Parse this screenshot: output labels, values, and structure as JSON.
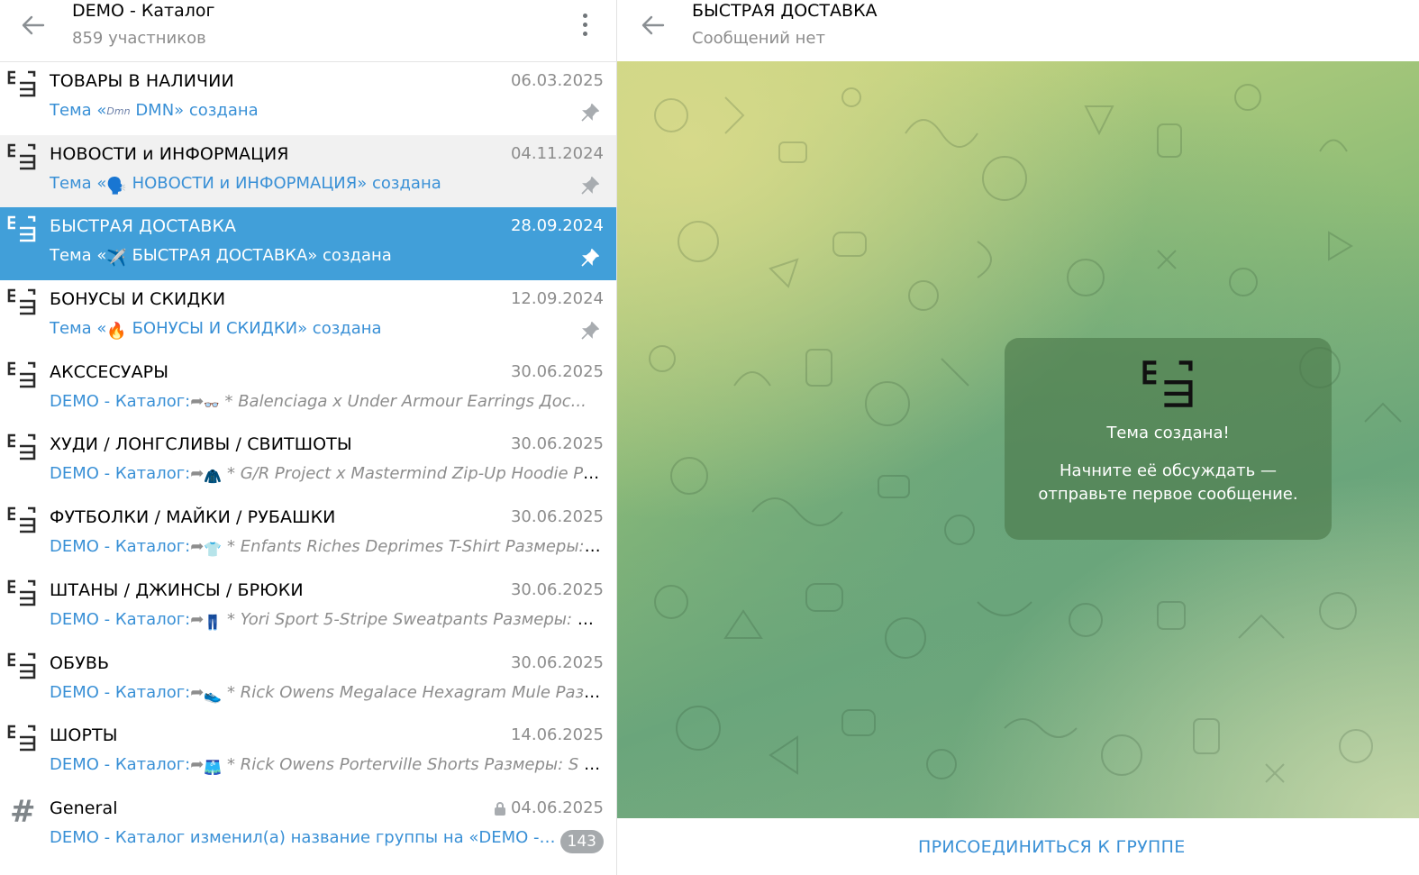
{
  "left_header": {
    "title": "DEMO - Каталог",
    "subtitle": "859 участников"
  },
  "topics": [
    {
      "title": "ТОВАРЫ В НАЛИЧИИ",
      "date": "06.03.2025",
      "pre": "Тема «",
      "emoji": "Dmn",
      "post": " DMN» создана",
      "pinned": true
    },
    {
      "title": "НОВОСТИ и ИНФОРМАЦИЯ",
      "date": "04.11.2024",
      "pre": "Тема «",
      "emoji": "🗣️",
      "post": " НОВОСТИ и ИНФОРМАЦИЯ» создана",
      "pinned": true
    },
    {
      "title": "БЫСТРАЯ ДОСТАВКА",
      "date": "28.09.2024",
      "pre": "Тема «",
      "emoji": "✈️",
      "post": " БЫСТРАЯ ДОСТАВКА» создана",
      "pinned": true
    },
    {
      "title": "БОНУСЫ И СКИДКИ",
      "date": "12.09.2024",
      "pre": "Тема «",
      "emoji": "🔥",
      "post": " БОНУСЫ И СКИДКИ» создана",
      "pinned": true
    },
    {
      "title": "АКССЕСУАРЫ",
      "date": "30.06.2025",
      "sender": "DEMO - Каталог:",
      "emoji": "👓",
      "text": " * Balenciaga x Under Armour Earrings   Дос..."
    },
    {
      "title": "ХУДИ / ЛОНГСЛИВЫ / СВИТШОТЫ",
      "date": "30.06.2025",
      "sender": "DEMO - Каталог:",
      "emoji": "🧥",
      "text": " * G/R Project x Mastermind Zip-Up Hoodie   Ра..."
    },
    {
      "title": "ФУТБОЛКИ / МАЙКИ / РУБАШКИ",
      "date": "30.06.2025",
      "sender": "DEMO - Каталог:",
      "emoji": "👕",
      "text": " * Enfants Riches Deprimes T-Shirt   Размеры: S..."
    },
    {
      "title": "ШТАНЫ / ДЖИНСЫ / БРЮКИ",
      "date": "30.06.2025",
      "sender": "DEMO - Каталог:",
      "emoji": "👖",
      "text": " * Yori Sport 5-Stripe Sweatpants   Размеры: S ..."
    },
    {
      "title": "ОБУВЬ",
      "date": "30.06.2025",
      "sender": "DEMO - Каталог:",
      "emoji": "👟",
      "text": " * Rick Owens Megalace Hexagram Mule   Разм..."
    },
    {
      "title": "ШОРТЫ",
      "date": "14.06.2025",
      "sender": "DEMO - Каталог:",
      "emoji": "🩳",
      "text": " * Rick Owens Porterville Shorts   Размеры: S - ..."
    },
    {
      "title": "General",
      "date": "04.06.2025",
      "preview": "DEMO - Каталог изменил(а) название группы на «DEMO - К...",
      "badge": "143"
    }
  ],
  "right_header": {
    "title": "БЫСТРАЯ ДОСТАВКА",
    "subtitle": "Сообщений нет"
  },
  "service": {
    "title": "Тема создана!",
    "text": "Начните её обсуждать — отправьте первое сообщение."
  },
  "bottom": {
    "join": "ПРИСОЕДИНИТЬСЯ К ГРУППЕ"
  },
  "colors": {
    "accent": "#419fd9",
    "link": "#3990d6",
    "muted": "#8d8d8d",
    "badge": "#a6aaad"
  },
  "icons": {
    "back": "arrow-left-icon",
    "menu": "more-vertical-icon",
    "topic": "topic-bracket-icon",
    "pin": "pin-icon",
    "hash": "hash-icon",
    "lock": "lock-icon",
    "forward": "forward-arrow-icon"
  }
}
